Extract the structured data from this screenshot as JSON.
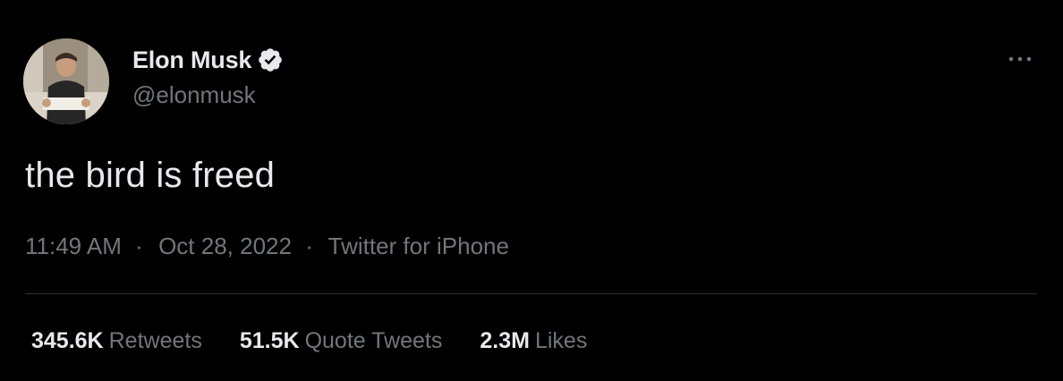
{
  "author": {
    "name": "Elon Musk",
    "handle": "@elonmusk",
    "verified": true
  },
  "tweet": {
    "text": "the bird is freed",
    "time": "11:49 AM",
    "date": "Oct 28, 2022",
    "source": "Twitter for iPhone",
    "separator": "·"
  },
  "stats": [
    {
      "count": "345.6K",
      "label": "Retweets"
    },
    {
      "count": "51.5K",
      "label": "Quote Tweets"
    },
    {
      "count": "2.3M",
      "label": "Likes"
    }
  ],
  "icons": {
    "verified": "verified-badge-icon",
    "more": "more-horizontal-icon"
  },
  "colors": {
    "background": "#000000",
    "primary_text": "#e7e9ea",
    "secondary_text": "#71767b",
    "divider": "#2f3336"
  }
}
